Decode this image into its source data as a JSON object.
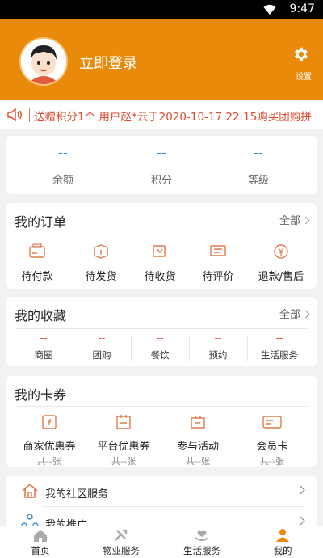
{
  "status_bar": {
    "time": "9:47"
  },
  "header": {
    "login_label": "立即登录",
    "settings_label": "设置"
  },
  "marquee": {
    "text": "送赠积分1个  用户赵*云于2020-10-17 22:15购买团购拼"
  },
  "stats": [
    {
      "value": "--",
      "label": "余额"
    },
    {
      "value": "--",
      "label": "积分"
    },
    {
      "value": "--",
      "label": "等级"
    }
  ],
  "orders": {
    "title": "我的订单",
    "all_label": "全部",
    "items": [
      {
        "label": "待付款",
        "icon": "wallet-icon"
      },
      {
        "label": "待发货",
        "icon": "package-icon"
      },
      {
        "label": "待收货",
        "icon": "truck-icon"
      },
      {
        "label": "待评价",
        "icon": "comment-icon"
      },
      {
        "label": "退款/售后",
        "icon": "refund-icon"
      }
    ]
  },
  "favorites": {
    "title": "我的收藏",
    "all_label": "全部",
    "items": [
      {
        "value": "--",
        "label": "商圈"
      },
      {
        "value": "--",
        "label": "团购"
      },
      {
        "value": "--",
        "label": "餐饮"
      },
      {
        "value": "--",
        "label": "预约"
      },
      {
        "value": "--",
        "label": "生活服务"
      }
    ]
  },
  "coupons": {
    "title": "我的卡券",
    "items": [
      {
        "label": "商家优惠券",
        "count": "共--张",
        "icon": "merchant-coupon-icon"
      },
      {
        "label": "平台优惠券",
        "count": "共--张",
        "icon": "platform-coupon-icon"
      },
      {
        "label": "参与活动",
        "count": "共--张",
        "icon": "activity-icon"
      },
      {
        "label": "会员卡",
        "count": "共--张",
        "icon": "member-card-icon"
      }
    ]
  },
  "services": [
    {
      "label": "我的社区服务",
      "icon": "house-icon"
    },
    {
      "label": "我的推广",
      "icon": "share-icon"
    }
  ],
  "tabs": [
    {
      "label": "首页",
      "icon": "home-icon"
    },
    {
      "label": "物业服务",
      "icon": "tools-icon"
    },
    {
      "label": "生活服务",
      "icon": "hands-icon"
    },
    {
      "label": "我的",
      "icon": "person-icon"
    }
  ],
  "colors": {
    "brand": "#ea8a0b",
    "accent_blue": "#2a8ec1",
    "accent_red": "#e0492d"
  }
}
